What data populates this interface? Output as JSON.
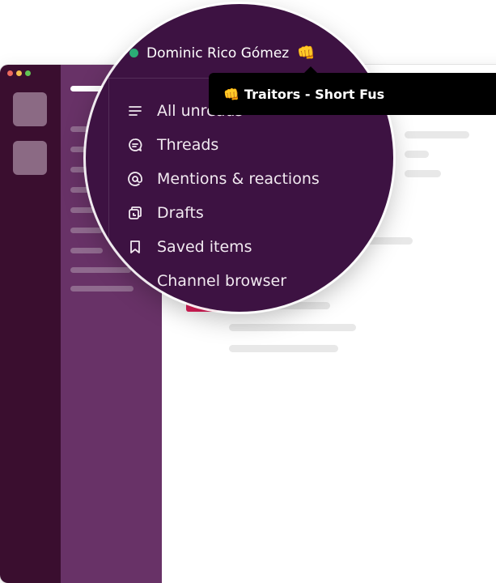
{
  "user": {
    "name": "Dominic Rico Gómez",
    "status_emoji": "👊",
    "presence_color": "#2bac76"
  },
  "tooltip": {
    "emoji": "👊",
    "text": "Traitors - Short Fus"
  },
  "menu": {
    "items": [
      {
        "label": "All unreads",
        "icon": "all-unreads-icon"
      },
      {
        "label": "Threads",
        "icon": "threads-icon"
      },
      {
        "label": "Mentions & reactions",
        "icon": "mentions-icon"
      },
      {
        "label": "Drafts",
        "icon": "drafts-icon"
      },
      {
        "label": "Saved items",
        "icon": "bookmark-icon"
      },
      {
        "label": "Channel browser",
        "icon": "channel-browser-icon"
      }
    ]
  },
  "colors": {
    "rail": "#3a0e2f",
    "sidebar": "#683267",
    "menu_bg": "#3d1242",
    "accent_pink": "#e01e5a",
    "traffic_lights": [
      "#ed6a5e",
      "#f4bf4f",
      "#61c554"
    ]
  }
}
